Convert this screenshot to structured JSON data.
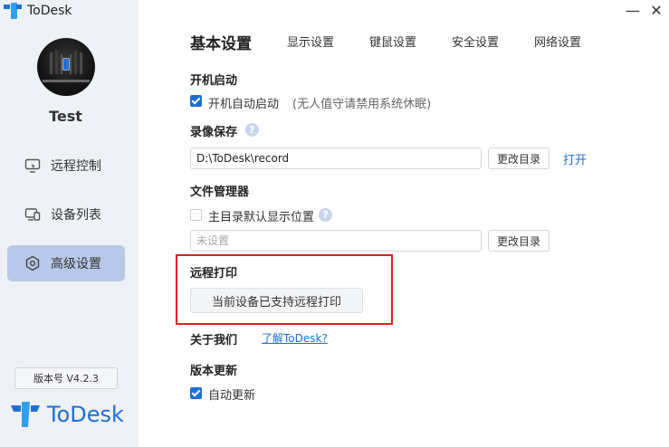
{
  "app": {
    "title": "ToDesk",
    "brand": "ToDesk"
  },
  "user": {
    "name": "Test"
  },
  "sidebar": {
    "items": [
      {
        "label": "远程控制",
        "icon": "remote-control-icon",
        "active": false
      },
      {
        "label": "设备列表",
        "icon": "device-list-icon",
        "active": false
      },
      {
        "label": "高级设置",
        "icon": "settings-icon",
        "active": true
      }
    ],
    "version": "版本号 V4.2.3"
  },
  "window": {
    "minimize": "—",
    "close": "✕"
  },
  "tabs": [
    "基本设置",
    "显示设置",
    "键鼠设置",
    "安全设置",
    "网络设置"
  ],
  "settings": {
    "startup": {
      "title": "开机启动",
      "checkbox_label": "开机自动启动",
      "checked": true,
      "hint": "(无人值守请禁用系统休眠)"
    },
    "recording": {
      "title": "录像保存",
      "path": "D:\\ToDesk\\record",
      "change_dir": "更改目录",
      "open": "打开"
    },
    "file_manager": {
      "title": "文件管理器",
      "checkbox_label": "主目录默认显示位置",
      "checked": false,
      "placeholder": "未设置",
      "change_dir": "更改目录"
    },
    "remote_print": {
      "title": "远程打印",
      "button": "当前设备已支持远程打印"
    },
    "about": {
      "title": "关于我们",
      "link": "了解ToDesk?"
    },
    "update": {
      "title": "版本更新",
      "checkbox_label": "自动更新",
      "checked": true
    }
  },
  "colors": {
    "accent": "#1d6fd9",
    "sidebar_bg": "#eef1f5",
    "active_nav": "#b6c9e8",
    "highlight": "#e02020"
  }
}
